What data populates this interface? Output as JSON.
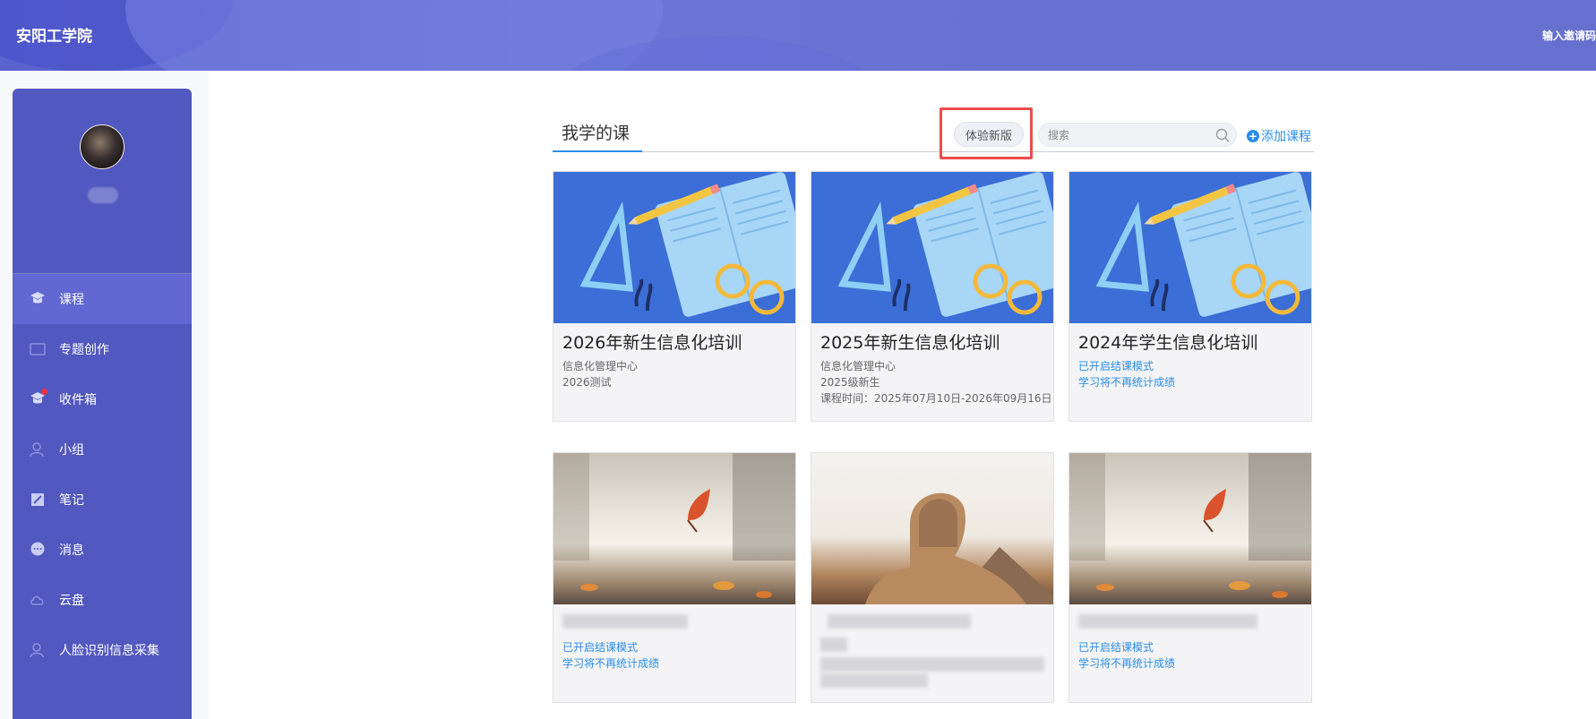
{
  "header": {
    "school_name": "安阳工学院",
    "invite_code_link": "输入邀请码"
  },
  "sidebar": {
    "items": [
      {
        "label": "课程",
        "icon": "course-icon",
        "active": true
      },
      {
        "label": "专题创作",
        "icon": "topic-icon",
        "active": false
      },
      {
        "label": "收件箱",
        "icon": "inbox-icon",
        "active": false,
        "badge": true
      },
      {
        "label": "小组",
        "icon": "group-icon",
        "active": false
      },
      {
        "label": "笔记",
        "icon": "note-icon",
        "active": false
      },
      {
        "label": "消息",
        "icon": "message-icon",
        "active": false
      },
      {
        "label": "云盘",
        "icon": "cloud-icon",
        "active": false
      },
      {
        "label": "人脸识别信息采集",
        "icon": "face-icon",
        "active": false
      }
    ]
  },
  "main": {
    "tab_label": "我学的课",
    "try_new_label": "体验新版",
    "search_placeholder": "搜索",
    "add_course_label": "添加课程"
  },
  "courses": [
    {
      "title": "2026年新生信息化培训",
      "lines": [
        "信息化管理中心",
        "2026测试"
      ],
      "cover": "book"
    },
    {
      "title": "2025年新生信息化培训",
      "lines": [
        "信息化管理中心",
        "2025级新生",
        "课程时间：2025年07月10日-2026年09月16日"
      ],
      "cover": "book"
    },
    {
      "title": "2024年学生信息化培训",
      "lines": [
        "已开启结课模式",
        "学习将不再统计成绩"
      ],
      "cover": "book"
    },
    {
      "title": "",
      "lines": [
        "已开启结课模式",
        "学习将不再统计成绩"
      ],
      "cover": "leaf"
    },
    {
      "title": "",
      "lines": [],
      "cover": "sphinx"
    },
    {
      "title": "",
      "lines": [
        "已开启结课模式",
        "学习将不再统计成绩"
      ],
      "cover": "leaf"
    }
  ],
  "colors": {
    "sidebar_bg": "#5158bf",
    "sidebar_active": "#6168d2",
    "accent_blue": "#2b8de5",
    "highlight_red": "#ef4c4c"
  }
}
